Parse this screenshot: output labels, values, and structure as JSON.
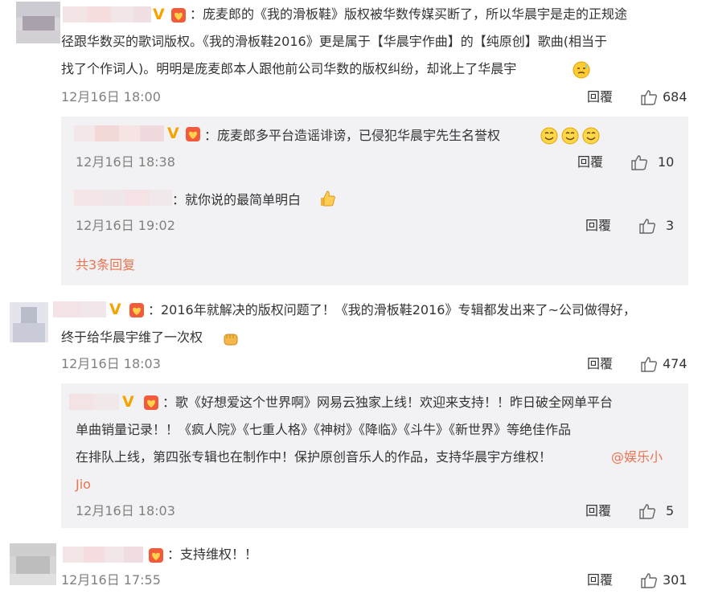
{
  "comments": [
    {
      "body_lines": [
        "：庞麦郎的《我的滑板鞋》版权被华数传媒买断了，所以华晨宇是走的正规途",
        "径跟华数买的歌词版权。《我的滑板鞋2016》更是属于【华晨宇作曲】的【纯原创】歌曲(相当于",
        "找了个作词人)。明明是庞麦郎本人跟他前公司华数的版权纠纷，却讹上了华晨宇"
      ],
      "time": "12月16日 18:00",
      "reply_label": "回覆",
      "likes": "684",
      "replies": [
        {
          "body": "：庞麦郎多平台造谣诽谤，已侵犯华晨宇先生名誉权",
          "time": "12月16日 18:38",
          "reply_label": "回覆",
          "likes": "10"
        },
        {
          "body": "：就你说的最简单明白",
          "time": "12月16日 19:02",
          "reply_label": "回覆",
          "likes": "3"
        }
      ],
      "more_replies": "共3条回复"
    },
    {
      "body_lines": [
        "：2016年就解决的版权问题了！《我的滑板鞋2016》专辑都发出来了~公司做得好，",
        "终于给华晨宇维了一次权"
      ],
      "time": "12月16日 18:03",
      "reply_label": "回覆",
      "likes": "474",
      "replies": [
        {
          "body_lines": [
            "：歌《好想爱这个世界啊》网易云独家上线！欢迎来支持！！昨日破全网单平台",
            "单曲销量记录！！《疯人院》《七重人格》《神树》《降临》《斗牛》《新世界》等绝佳作品",
            "在排队上线，第四张专辑也在制作中！保护原创音乐人的作品，支持华晨宇方维权！"
          ],
          "mention_a": "@娱乐小",
          "mention_b": "Jio",
          "time": "12月16日 18:03",
          "reply_label": "回覆",
          "likes": "5"
        }
      ]
    },
    {
      "body": "：支持维权！！",
      "time": "12月16日 17:55",
      "reply_label": "回覆",
      "likes": "301"
    }
  ],
  "colors": {
    "meta": "#808080",
    "link": "#eb7350",
    "verified": "#f5a300",
    "reply_bg": "#f2f2f5"
  }
}
